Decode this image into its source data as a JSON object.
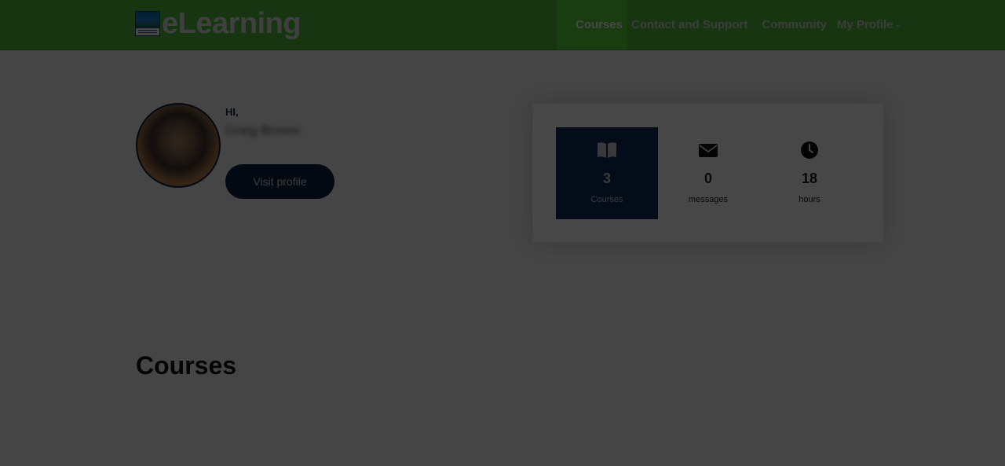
{
  "header": {
    "logo_text": "eLearning",
    "nav": [
      {
        "label": "Courses",
        "active": true
      },
      {
        "label": "Contact and Support",
        "active": false
      },
      {
        "label": "Community",
        "active": false
      },
      {
        "label": "My Profile",
        "active": false,
        "has_dropdown": true
      }
    ],
    "colors": {
      "header_bg": "#4fbf3a",
      "active_nav_bg": "#59d93d"
    }
  },
  "profile": {
    "greeting": "HI,",
    "name": "Craig Brown",
    "visit_button": "Visit profile"
  },
  "stats": [
    {
      "icon": "book-icon",
      "value": "3",
      "label": "Courses",
      "active": true
    },
    {
      "icon": "envelope-icon",
      "value": "0",
      "label": "messages",
      "active": false
    },
    {
      "icon": "clock-icon",
      "value": "18",
      "label": "hours",
      "active": false
    }
  ],
  "main": {
    "section_title": "Courses"
  },
  "colors": {
    "navy": "#0d2c57",
    "dim_overlay": "rgba(0,0,0,0.72)"
  }
}
